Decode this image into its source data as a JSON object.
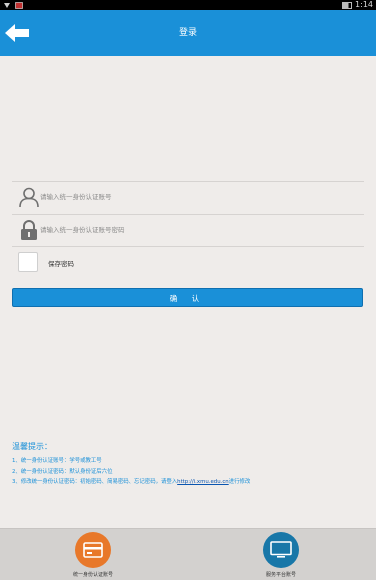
{
  "statusbar": {
    "time": "1:14"
  },
  "header": {
    "title": "登录"
  },
  "login": {
    "username_placeholder": "请输入统一身份认证账号",
    "password_placeholder": "请输入统一身份认证账号密码",
    "remember_label": "保存密码",
    "confirm_label": "确 认"
  },
  "tips": {
    "title": "温馨提示：",
    "items": [
      "1、统一身份认证账号：学号或教工号",
      "2、统一身份认证密码：默认身份证后六位",
      "3、修改统一身份认证密码：初始密码、简易密码、忘记密码，请登入"
    ],
    "link": "http://i.xmu.edu.cn",
    "suffix": "进行修改"
  },
  "bottom_nav": [
    {
      "label": "统一身份认证账号",
      "color": "#e8782a"
    },
    {
      "label": "服务平台账号",
      "color": "#1877a8"
    }
  ]
}
